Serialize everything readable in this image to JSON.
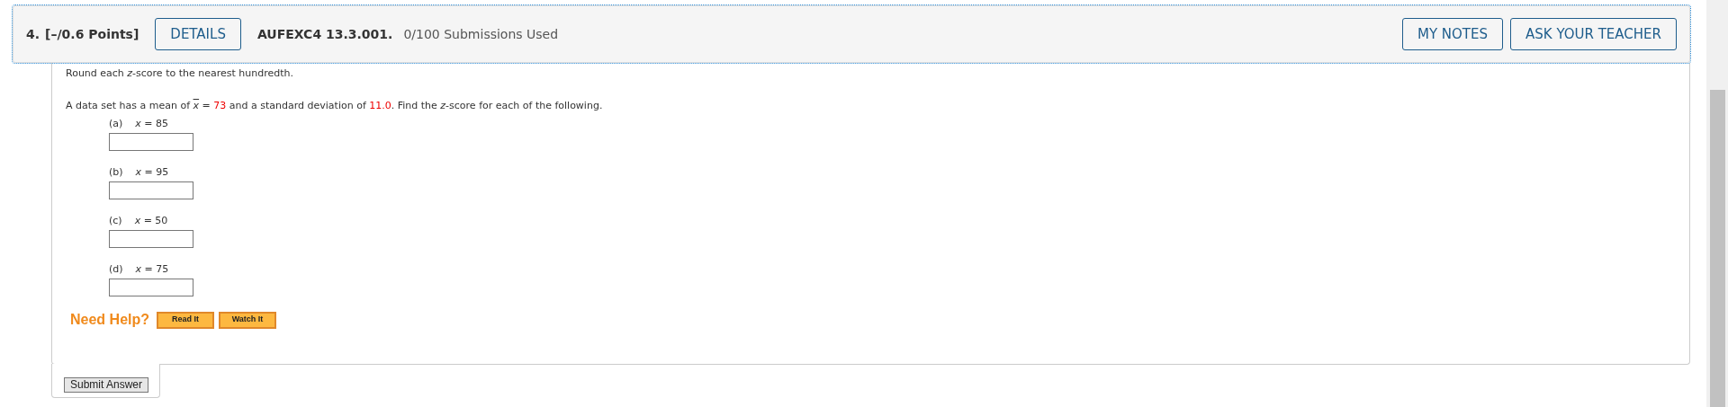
{
  "header": {
    "number": "4.",
    "points": "[–/0.6 Points]",
    "details_button": "DETAILS",
    "code": "AUFEXC4 13.3.001.",
    "submissions": "0/100 Submissions Used",
    "buttons": [
      "MY NOTES",
      "ASK YOUR TEACHER"
    ]
  },
  "instruction": "Round each *z*-score to the nearest hundredth.",
  "statement": [
    {
      "kind": "text",
      "text": "A data set has a mean of "
    },
    {
      "kind": "xbar",
      "text": "x"
    },
    {
      "kind": "text",
      "text": " = "
    },
    {
      "kind": "value",
      "text": "73"
    },
    {
      "kind": "text",
      "text": " and a standard deviation of "
    },
    {
      "kind": "value",
      "text": "11.0"
    },
    {
      "kind": "text",
      "text": ". Find the *z*-score for each of the following."
    }
  ],
  "parts": [
    {
      "label": "(a)",
      "equation": "*x* = 85"
    },
    {
      "label": "(b)",
      "equation": "*x* = 95"
    },
    {
      "label": "(c)",
      "equation": "*x* = 50"
    },
    {
      "label": "(d)",
      "equation": "*x* = 75"
    }
  ],
  "help": {
    "label": "Need Help?",
    "buttons": [
      "Read It",
      "Watch It"
    ]
  },
  "submit_button": "Submit Answer"
}
